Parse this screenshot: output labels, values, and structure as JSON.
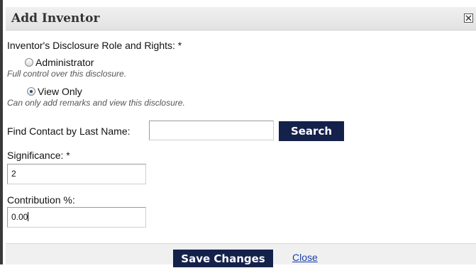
{
  "dialog": {
    "title": "Add Inventor",
    "close_icon": "close-x-icon"
  },
  "role_section": {
    "label": "Inventor's Disclosure Role and Rights:",
    "required_marker": "*",
    "options": [
      {
        "label": "Administrator",
        "hint": "Full control over this disclosure.",
        "checked": false
      },
      {
        "label": "View Only",
        "hint": "Can only add remarks and view this disclosure.",
        "checked": true
      }
    ]
  },
  "find_contact": {
    "label": "Find Contact by Last Name:",
    "value": "",
    "search_label": "Search"
  },
  "significance": {
    "label": "Significance:",
    "required_marker": "*",
    "value": "2"
  },
  "contribution": {
    "label": "Contribution %:",
    "value": "0.00"
  },
  "footer": {
    "save_label": "Save Changes",
    "close_label": "Close"
  },
  "colors": {
    "button_bg": "#14214a",
    "link": "#1a3fb0"
  }
}
